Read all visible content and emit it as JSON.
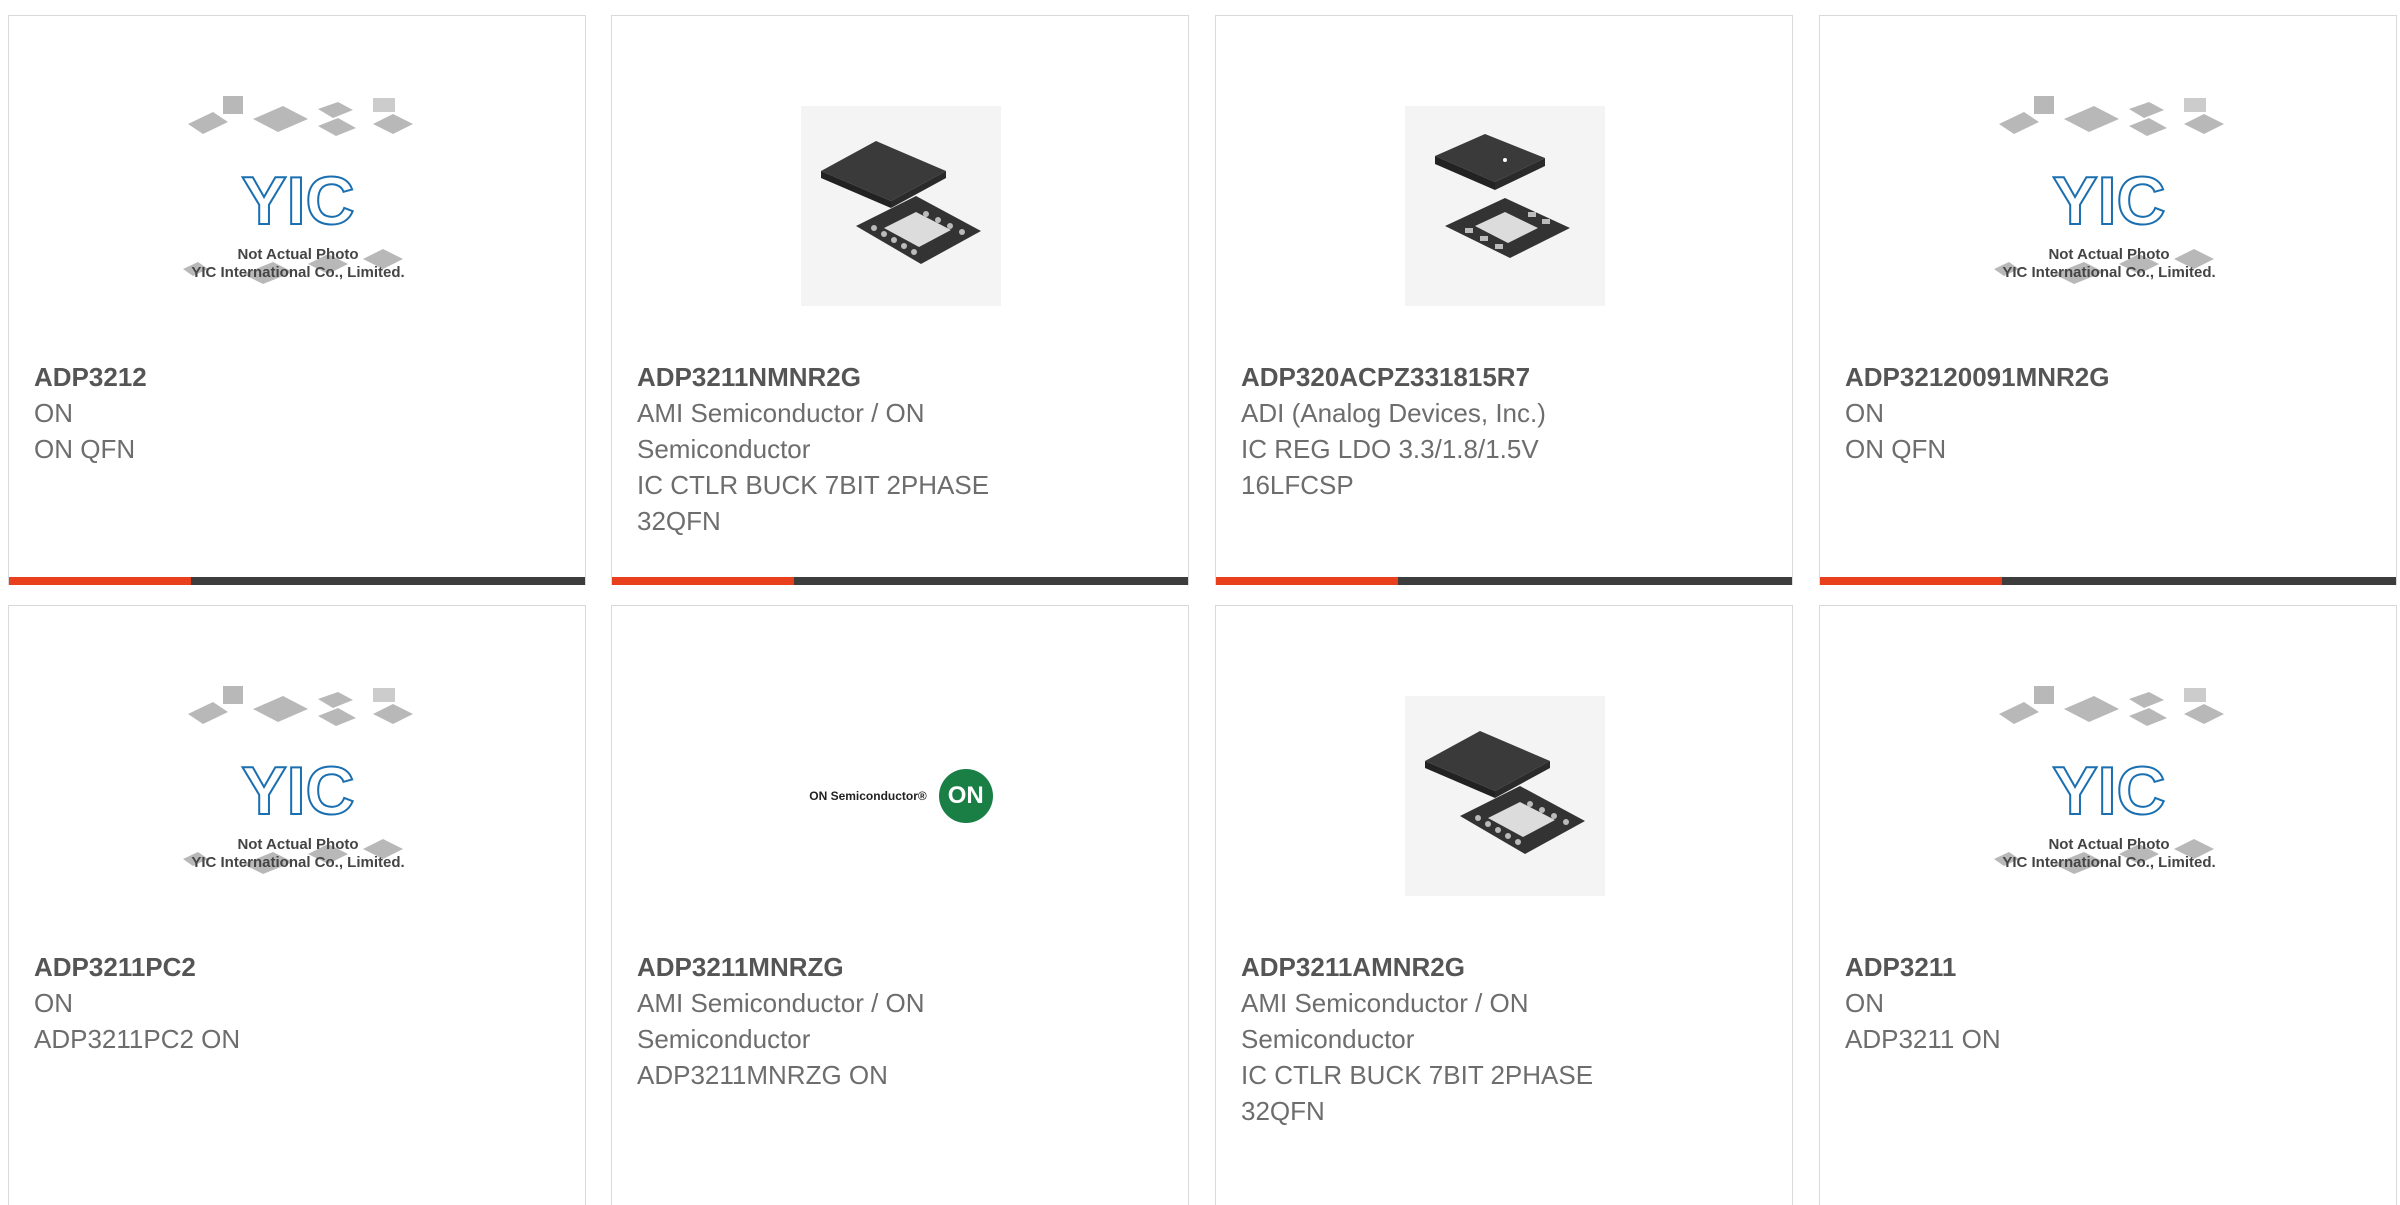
{
  "placeholder": {
    "logo_text": "YIC",
    "caption_line1": "Not Actual Photo",
    "caption_line2": "YIC International Co., Limited."
  },
  "on_logo": {
    "wordmark": "ON Semiconductor®",
    "badge": "ON"
  },
  "colors": {
    "accent": "#e8401c",
    "bar": "#3d3d3d",
    "yic_blue": "#1a6fb0"
  },
  "products": [
    {
      "part": "ADP3212",
      "maker": "ON",
      "maker2": "",
      "desc": "ON QFN",
      "desc2": "",
      "image": "placeholder"
    },
    {
      "part": "ADP3211NMNR2G",
      "maker": "AMI Semiconductor / ON",
      "maker2": "Semiconductor",
      "desc": "IC CTLR BUCK 7BIT 2PHASE",
      "desc2": "32QFN",
      "image": "qfn-32"
    },
    {
      "part": "ADP320ACPZ331815R7",
      "maker": "ADI (Analog Devices, Inc.)",
      "maker2": "",
      "desc": "IC REG LDO 3.3/1.8/1.5V",
      "desc2": "16LFCSP",
      "image": "lfcsp-16"
    },
    {
      "part": "ADP32120091MNR2G",
      "maker": "ON",
      "maker2": "",
      "desc": "ON QFN",
      "desc2": "",
      "image": "placeholder"
    },
    {
      "part": "ADP3211PC2",
      "maker": "ON",
      "maker2": "",
      "desc": "ADP3211PC2 ON",
      "desc2": "",
      "image": "placeholder"
    },
    {
      "part": "ADP3211MNRZG",
      "maker": "AMI Semiconductor / ON",
      "maker2": "Semiconductor",
      "desc": "ADP3211MNRZG ON",
      "desc2": "",
      "image": "on-logo"
    },
    {
      "part": "ADP3211AMNR2G",
      "maker": "AMI Semiconductor / ON",
      "maker2": "Semiconductor",
      "desc": "IC CTLR BUCK 7BIT 2PHASE",
      "desc2": "32QFN",
      "image": "qfn-32"
    },
    {
      "part": "ADP3211",
      "maker": "ON",
      "maker2": "",
      "desc": "ADP3211 ON",
      "desc2": "",
      "image": "placeholder"
    }
  ]
}
